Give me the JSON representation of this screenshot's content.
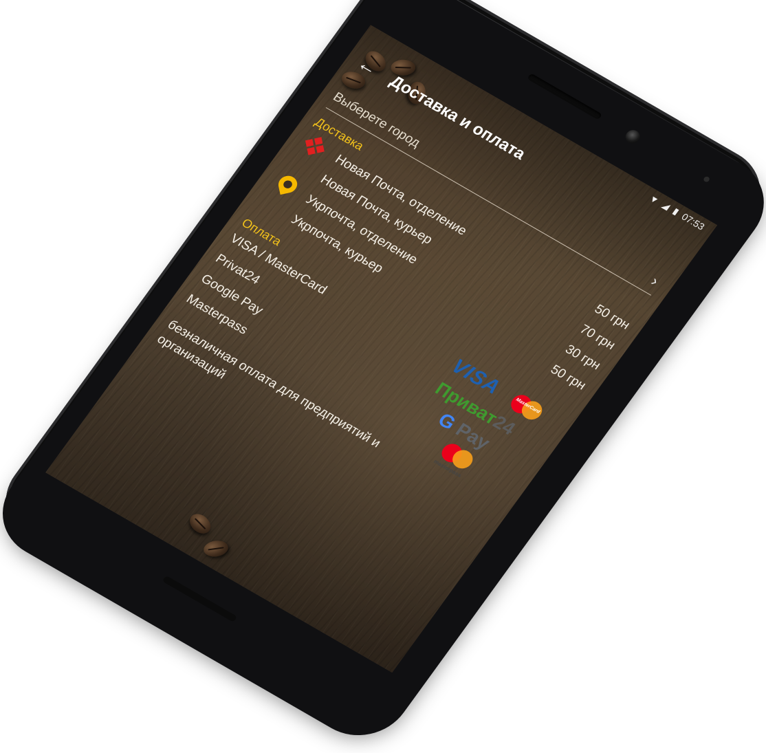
{
  "statusbar": {
    "time": "07:53",
    "wifi_icon": "wifi-icon",
    "signal_icon": "signal-icon",
    "battery_icon": "battery-icon"
  },
  "toolbar": {
    "title": "Доставка и оплата",
    "back_icon": "back-arrow-icon",
    "back_glyph": "←"
  },
  "city_select": {
    "placeholder": "Выберете город",
    "chevron_glyph": "›"
  },
  "delivery": {
    "section_label": "Доставка",
    "items": [
      {
        "label": "Новая Почта, отделение",
        "price": "50 грн",
        "icon": "nova-poshta-icon"
      },
      {
        "label": "Новая Почта, курьер",
        "price": "70 грн"
      },
      {
        "label": "Укрпочта, отделение",
        "price": "30 грн",
        "icon": "ukrposhta-icon"
      },
      {
        "label": "Укрпочта, курьер",
        "price": "50 грн"
      }
    ]
  },
  "payment": {
    "section_label": "Оплата",
    "items": [
      {
        "label": "VISA / MasterCard",
        "logo": "visa-mastercard-logo"
      },
      {
        "label": "Privat24",
        "logo": "privat24-logo"
      },
      {
        "label": "Google Pay",
        "logo": "google-pay-logo"
      },
      {
        "label": "Masterpass",
        "logo": "masterpass-logo"
      }
    ],
    "note": "безналичная оплата для предприятий и организаций"
  },
  "logos": {
    "visa_text": "VISA",
    "mastercard_text": "MasterCard",
    "privat_text": "Приват",
    "privat_num": "24",
    "gpay_g": "G",
    "gpay_pay": "Pay",
    "masterpass_text": "masterpass"
  },
  "colors": {
    "accent": "#f2c21b",
    "text": "#f4efe6",
    "nova_poshta": "#e02020",
    "ukrposhta": "#f5b800"
  }
}
